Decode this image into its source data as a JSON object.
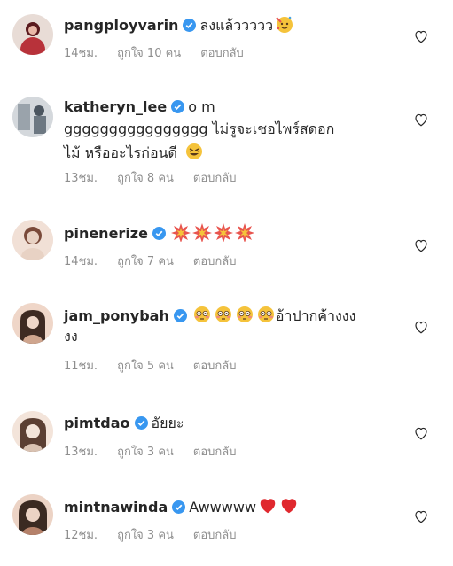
{
  "comments": [
    {
      "username": "pangployvarin",
      "text": "ลงแล้ววววว",
      "emojis": [
        "party-face"
      ],
      "time": "14ชม.",
      "likes": "ถูกใจ 10 คน",
      "reply": "ตอบกลับ",
      "avatar_colors": [
        "#b8323a",
        "#e9b8a8",
        "#5a1a1e"
      ]
    },
    {
      "username": "katheryn_lee",
      "text": "o m",
      "text_line2": "gggggggggggggggg ไม่รูจะเชอไพร์สดอก",
      "text_line3": "ไม้ หรืออะไรก่อนดี",
      "emojis": [
        "grinning-squint-face"
      ],
      "time": "13ชม.",
      "likes": "ถูกใจ 8 คน",
      "reply": "ตอบกลับ",
      "avatar_colors": [
        "#d4d8dc",
        "#9aa3ab",
        "#4c5660"
      ]
    },
    {
      "username": "pinenerize",
      "text": "",
      "emojis": [
        "collision",
        "collision",
        "collision",
        "collision"
      ],
      "time": "14ชม.",
      "likes": "ถูกใจ 7 คน",
      "reply": "ตอบกลับ",
      "avatar_colors": [
        "#e8d2c4",
        "#f1e0d6",
        "#7a4a3a"
      ]
    },
    {
      "username": "jam_ponybah",
      "text": "อ้าปากค้างงง",
      "text_line2": "งง",
      "emojis": [
        "flushed-face",
        "flushed-face",
        "flushed-face",
        "flushed-face"
      ],
      "time": "11ชม.",
      "likes": "ถูกใจ 5 คน",
      "reply": "ตอบกลับ",
      "avatar_colors": [
        "#cfa58e",
        "#efd6c8",
        "#3e2a22"
      ]
    },
    {
      "username": "pimtdao",
      "text": "อัยยะ",
      "emojis": [],
      "time": "13ชม.",
      "likes": "ถูกใจ 3 คน",
      "reply": "ตอบกลับ",
      "avatar_colors": [
        "#d9c2b2",
        "#f3e4da",
        "#5b3f33"
      ]
    },
    {
      "username": "mintnawinda",
      "text": "Awwwww",
      "emojis": [
        "red-heart",
        "red-heart"
      ],
      "time": "12ชม.",
      "likes": "ถูกใจ 3 คน",
      "reply": "ตอบกลับ",
      "avatar_colors": [
        "#b5816a",
        "#ecd3c5",
        "#3b2a22"
      ]
    }
  ],
  "colors": {
    "verified": "#3897f0",
    "meta_text": "#8e8e8e",
    "heart_outline": "#262626"
  }
}
